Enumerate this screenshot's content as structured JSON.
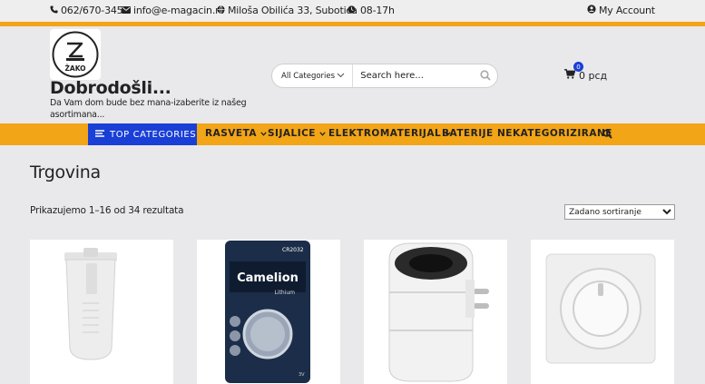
{
  "topbar": {
    "phone": "062/670-345",
    "email": "info@e-magacin.rs",
    "address": "Miloša Obilića 33, Subotica",
    "hours": "08-17h",
    "account": "My Account"
  },
  "header": {
    "logo_text": "ŽAKO",
    "title": "Dobrodošli...",
    "description": "Da Vam dom bude bez mana-izaberite iz našeg asortimana..."
  },
  "search": {
    "category": "All Categories",
    "placeholder": "Search here..."
  },
  "cart": {
    "count": "0",
    "total": "0 рсд"
  },
  "nav": {
    "top_categories": "TOP CATEGORIES",
    "items": [
      {
        "label": "RASVETA"
      },
      {
        "label": "SIJALICE"
      },
      {
        "label": "ELEKTROMATERIJAL"
      },
      {
        "label": "BATERIJE"
      },
      {
        "label": "NEKATEGORIZIRANE"
      }
    ]
  },
  "shop": {
    "title": "Trgovina",
    "result_count": "Prikazujemo 1–16 od 34 rezultata",
    "ordering": "Zadano sortiranje"
  },
  "products": [
    {
      "image": "white-plastic-cap"
    },
    {
      "image": "camelion-battery",
      "brand": "Camelion",
      "sub": "Lithium",
      "model": "CR2032",
      "voltage": "3V"
    },
    {
      "image": "triple-socket-adapter"
    },
    {
      "image": "dimmer-switch"
    }
  ],
  "colors": {
    "accent": "#f2a516",
    "brand_blue": "#1a3fd6"
  }
}
